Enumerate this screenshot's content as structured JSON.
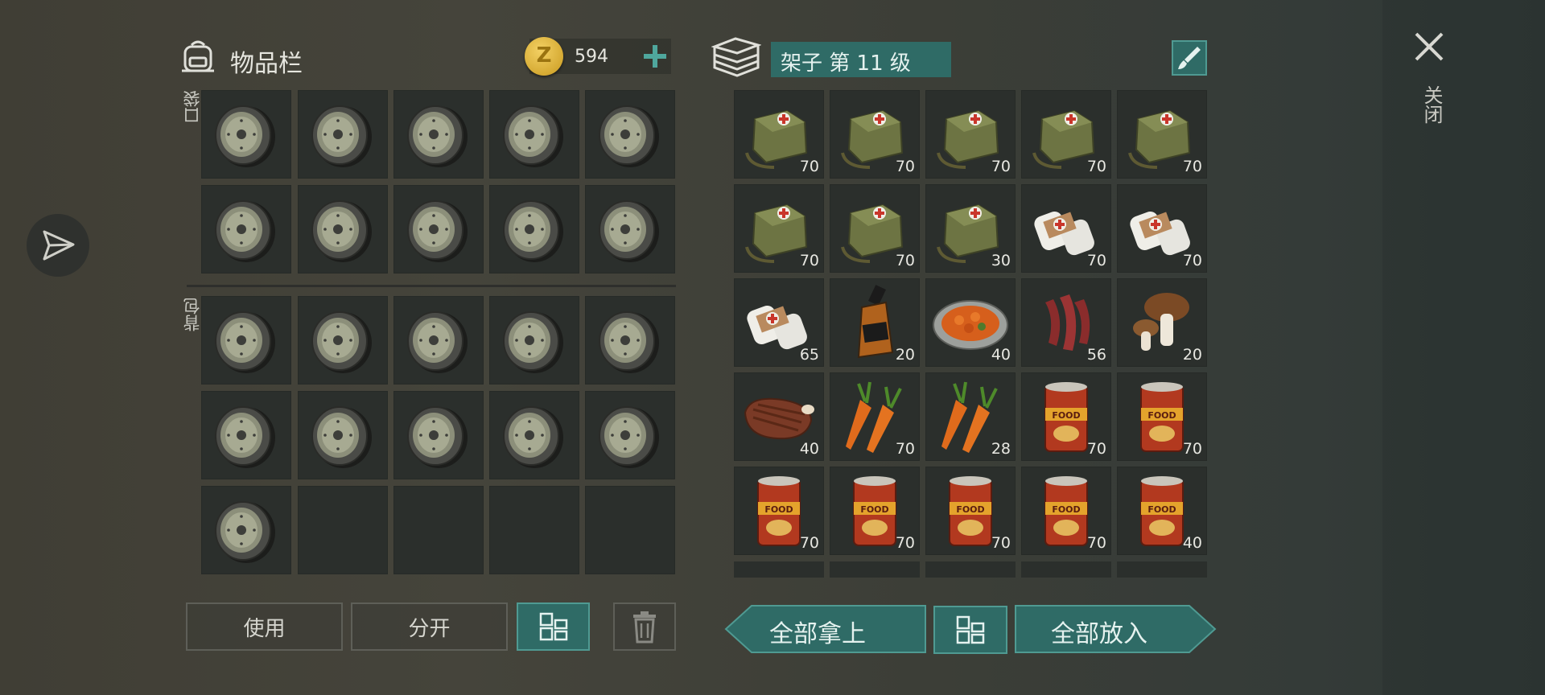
{
  "inventory": {
    "title": "物品栏",
    "icon": "backpack-icon",
    "coins": "594",
    "coin_symbol": "Z",
    "pocket_label": "口袋",
    "backpack_label": "背包",
    "pocket_items": [
      "disc",
      "disc",
      "disc",
      "disc",
      "disc",
      "disc",
      "disc",
      "disc",
      "disc",
      "disc"
    ],
    "backpack_items": [
      "disc",
      "disc",
      "disc",
      "disc",
      "disc",
      "disc",
      "disc",
      "disc",
      "disc",
      "disc",
      "disc",
      "",
      "",
      "",
      ""
    ]
  },
  "container": {
    "title": "架子 第 11 级",
    "icon": "shelf-icon",
    "items": [
      {
        "kind": "medkit",
        "qty": "70"
      },
      {
        "kind": "medkit",
        "qty": "70"
      },
      {
        "kind": "medkit",
        "qty": "70"
      },
      {
        "kind": "medkit",
        "qty": "70"
      },
      {
        "kind": "medkit",
        "qty": "70"
      },
      {
        "kind": "medkit",
        "qty": "70"
      },
      {
        "kind": "medkit",
        "qty": "70"
      },
      {
        "kind": "medkit",
        "qty": "30"
      },
      {
        "kind": "bandage",
        "qty": "70"
      },
      {
        "kind": "bandage",
        "qty": "70"
      },
      {
        "kind": "bandage",
        "qty": "65"
      },
      {
        "kind": "whiskey",
        "qty": "20"
      },
      {
        "kind": "stew",
        "qty": "40"
      },
      {
        "kind": "bacon",
        "qty": "56"
      },
      {
        "kind": "mushroom",
        "qty": "20"
      },
      {
        "kind": "steak",
        "qty": "40"
      },
      {
        "kind": "carrot",
        "qty": "70"
      },
      {
        "kind": "carrot",
        "qty": "28"
      },
      {
        "kind": "can",
        "qty": "70"
      },
      {
        "kind": "can",
        "qty": "70"
      },
      {
        "kind": "can",
        "qty": "70"
      },
      {
        "kind": "can",
        "qty": "70"
      },
      {
        "kind": "can",
        "qty": "70"
      },
      {
        "kind": "can",
        "qty": "70"
      },
      {
        "kind": "can",
        "qty": "40"
      }
    ]
  },
  "buttons": {
    "use": "使用",
    "split": "分开",
    "take_all": "全部拿上",
    "put_all": "全部放入"
  },
  "close": {
    "label": "关闭"
  },
  "colors": {
    "teal": "#2f6b66",
    "teal_border": "#4f9a92",
    "slot": "#2b2f2c"
  }
}
